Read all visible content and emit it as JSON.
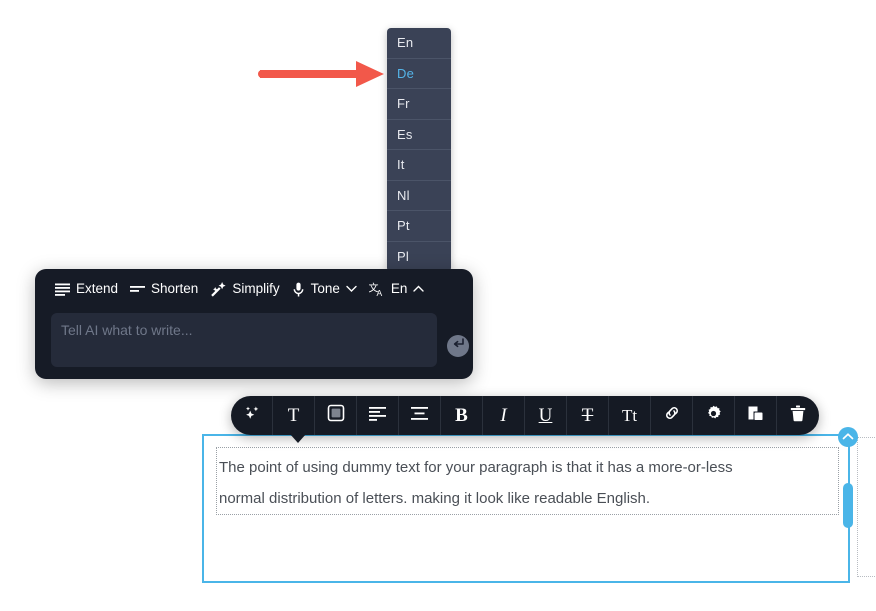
{
  "language_dropdown": {
    "name": "language-selector",
    "selected": "De",
    "options": [
      "En",
      "De",
      "Fr",
      "Es",
      "It",
      "Nl",
      "Pt",
      "Pl"
    ],
    "background_color": "#3a4256",
    "active_color": "#54b4e8",
    "text_color": "#e8eaef"
  },
  "annotation": {
    "arrow_color": "#f2584a",
    "arrow_name": "red-pointer-arrow"
  },
  "ai_panel": {
    "background_color": "#161b26",
    "actions": [
      {
        "label": "Extend",
        "icon": "text-lines-icon",
        "has_chevron": false
      },
      {
        "label": "Shorten",
        "icon": "text-lines-short-icon",
        "has_chevron": false
      },
      {
        "label": "Simplify",
        "icon": "magic-wand-icon",
        "has_chevron": false
      },
      {
        "label": "Tone",
        "icon": "microphone-icon",
        "has_chevron": true,
        "chevron": "down"
      },
      {
        "label": "En",
        "icon": "translate-icon",
        "has_chevron": true,
        "chevron": "up"
      }
    ],
    "input": {
      "placeholder": "Tell AI what to write...",
      "value": "",
      "background_color": "#252b3a"
    },
    "submit_button": {
      "icon": "enter-arrow-icon",
      "color": "#6f7789"
    }
  },
  "format_toolbar": {
    "background_color": "#151a24",
    "buttons": [
      {
        "name": "ai-sparkles-button",
        "icon": "sparkles-icon",
        "glyph": ""
      },
      {
        "name": "text-style-button",
        "icon": "text-T-icon",
        "glyph": "T"
      },
      {
        "name": "background-color-button",
        "icon": "filled-square-icon",
        "glyph": ""
      },
      {
        "name": "align-left-button",
        "icon": "align-left-icon",
        "glyph": ""
      },
      {
        "name": "align-center-button",
        "icon": "align-center-icon",
        "glyph": ""
      },
      {
        "name": "bold-button",
        "icon": "bold-B-icon",
        "glyph": "B"
      },
      {
        "name": "italic-button",
        "icon": "italic-I-icon",
        "glyph": "I"
      },
      {
        "name": "underline-button",
        "icon": "underline-U-icon",
        "glyph": "U"
      },
      {
        "name": "strikethrough-button",
        "icon": "strikethrough-T-icon",
        "glyph": "T"
      },
      {
        "name": "font-size-button",
        "icon": "font-size-Tt-icon",
        "glyph": "Tt"
      },
      {
        "name": "link-button",
        "icon": "link-chain-icon",
        "glyph": ""
      },
      {
        "name": "settings-button",
        "icon": "gear-icon",
        "glyph": ""
      },
      {
        "name": "duplicate-button",
        "icon": "copy-icon",
        "glyph": ""
      },
      {
        "name": "delete-button",
        "icon": "trash-icon",
        "glyph": ""
      }
    ]
  },
  "content": {
    "paragraph_line_1": "The point of using dummy text for your paragraph is that it has a more-or-less",
    "paragraph_line_2": "normal distribution of letters. making it look like readable English.",
    "selection_border_color": "#4ab5e8",
    "text_color": "#4a4f56",
    "collapse_handle_icon": "chevron-up-icon",
    "scroll_handle_name": "vertical-resize-handle"
  }
}
